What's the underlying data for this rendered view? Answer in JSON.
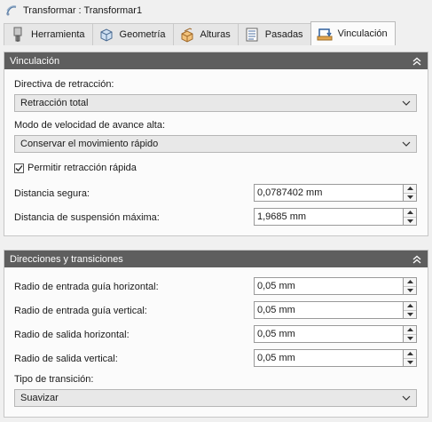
{
  "window": {
    "title": "Transformar : Transformar1",
    "icon": "transform-icon"
  },
  "tabs": [
    {
      "label": "Herramienta",
      "icon": "tool-icon",
      "active": false
    },
    {
      "label": "Geometría",
      "icon": "geometry-icon",
      "active": false
    },
    {
      "label": "Alturas",
      "icon": "heights-icon",
      "active": false
    },
    {
      "label": "Pasadas",
      "icon": "passes-icon",
      "active": false
    },
    {
      "label": "Vinculación",
      "icon": "linking-icon",
      "active": true
    }
  ],
  "vinculacion": {
    "header": "Vinculación",
    "retract_label": "Directiva de retracción:",
    "retract_value": "Retracción total",
    "feed_label": "Modo de velocidad de avance alta:",
    "feed_value": "Conservar el movimiento rápido",
    "rapid_label": "Permitir retracción rápida",
    "rapid_checked": true,
    "safe_label": "Distancia segura:",
    "safe_value": "0,0787402 mm",
    "hover_label": "Distancia de suspensión máxima:",
    "hover_value": "1,9685 mm"
  },
  "directions": {
    "header": "Direcciones y transiciones",
    "lead_in_h_label": "Radio de entrada guía horizontal:",
    "lead_in_h_value": "0,05 mm",
    "lead_in_v_label": "Radio de entrada guía vertical:",
    "lead_in_v_value": "0,05 mm",
    "lead_out_h_label": "Radio de salida horizontal:",
    "lead_out_h_value": "0,05 mm",
    "lead_out_v_label": "Radio de salida vertical:",
    "lead_out_v_value": "0,05 mm",
    "transition_label": "Tipo de transición:",
    "transition_value": "Suavizar"
  }
}
